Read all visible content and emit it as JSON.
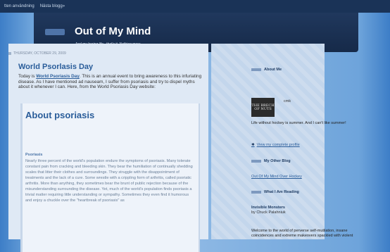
{
  "topbar": {
    "items": [
      "tten användning",
      "Nästa blogg»"
    ]
  },
  "header": {
    "title": "Out of My Mind",
    "description": "And my boring life...that's it. Nothing more."
  },
  "post": {
    "date": "THURSDAY, OCTOBER 29, 2009",
    "title": "World Psorlasis Day",
    "intro_before": "Today is ",
    "intro_link": "World Psoriasis Day",
    "intro_after": ". This is an annual event to bring awareness to this infuriating disease. As I have mentioned ad nauseam, I suffer from psoriasis and try to dispel myths about it whenever I can. Here, from the World Psoriasis Day website:",
    "embed_heading": "About psoriasis",
    "embed_subheading": "Psoriasis",
    "embed_body": "Nearly three percent of the world's population endure the symptoms of psoriasis. Many tolerate constant pain from cracking and bleeding skin. They bear the humiliation of continually shedding scales that litter their clothes and surroundings. They struggle with the disappointment of treatments and the lack of a cure. Some wrestle with a crippling form of arthritis, called psoriatic arthritis. More than anything, they sometimes bear the brunt of public rejection because of the misunderstanding surrounding the disease. Yet, much of the world's population finds psoriasis a trivial matter requiring little understanding or sympathy. Sometimes they even find it humorous and enjoy a chuckle over the \"heartbreak of psoriasis\" as"
  },
  "sidebar": {
    "about_heading": "About Me",
    "avatar_text": "THE BRECH OF NUTS",
    "author": "cmk",
    "about_text": "Life without hockey is summer. And I can't like summer!",
    "profile_link": "View my complete profile",
    "other_blog_heading": "My Other Blog",
    "other_blog_link": "Out Of My Mind Over Hockey",
    "reading_heading": "What I Am Reading",
    "book_title": "Invisible Monsters",
    "book_author": "by Chuck Palahniuk",
    "book_desc": "Welcome to the world of perverse self-mutilation, insane coincidences and extreme makeovers spackled with violent"
  }
}
